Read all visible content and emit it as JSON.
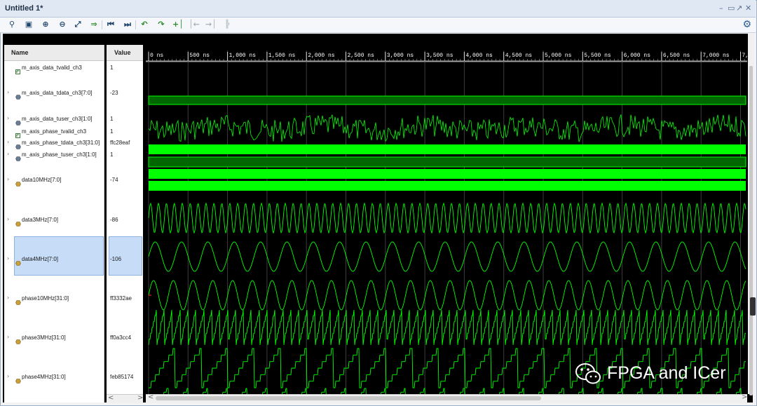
{
  "window": {
    "title": "Untitled 1*"
  },
  "toolbar": {
    "icons": [
      "search-icon",
      "save-icon",
      "zoom-in-icon",
      "zoom-out-icon",
      "zoom-fit-icon",
      "go-to-cursor-icon",
      "go-to-time-0-icon",
      "go-to-last-time-icon",
      "previous-transition-icon",
      "next-transition-icon",
      "add-marker-icon",
      "previous-marker-icon",
      "next-marker-icon",
      "swap-cursors-icon",
      "settings-gear-icon"
    ]
  },
  "columns": {
    "name": "Name",
    "value": "Value"
  },
  "signals": [
    {
      "name": "m_axis_data_tvalid_ch3",
      "value": "1",
      "type": "bit",
      "expandable": false
    },
    {
      "name": "m_axis_data_tdata_ch3[7:0]",
      "value": "-23",
      "type": "bus",
      "expandable": true
    },
    {
      "name": "m_axis_data_tuser_ch3[1:0]",
      "value": "1",
      "type": "bus",
      "expandable": true
    },
    {
      "name": "m_axis_phase_tvalid_ch3",
      "value": "1",
      "type": "bit",
      "expandable": false
    },
    {
      "name": "m_axis_phase_tdata_ch3[31:0]",
      "value": "ffc28eaf",
      "type": "bus",
      "expandable": true
    },
    {
      "name": "m_axis_phase_tuser_ch3[1:0]",
      "value": "1",
      "type": "bus",
      "expandable": true
    },
    {
      "name": "data10MHz[7:0]",
      "value": "-74",
      "type": "analog",
      "expandable": true
    },
    {
      "name": "data3MHz[7:0]",
      "value": "-86",
      "type": "analog",
      "expandable": true
    },
    {
      "name": "data4MHz[7:0]",
      "value": "-106",
      "type": "analog",
      "expandable": true,
      "selected": true
    },
    {
      "name": "phase10MHz[31:0]",
      "value": "ff3332ae",
      "type": "analog",
      "expandable": true
    },
    {
      "name": "phase3MHz[31:0]",
      "value": "ff0a3cc4",
      "type": "analog",
      "expandable": true
    },
    {
      "name": "phase4MHz[31:0]",
      "value": "feb85174",
      "type": "analog",
      "expandable": true
    }
  ],
  "timeline": {
    "labels": [
      "0 ns",
      "500 ns",
      "1,000 ns",
      "1,500 ns",
      "2,000 ns",
      "2,500 ns",
      "3,000 ns",
      "3,500 ns",
      "4,000 ns",
      "4,500 ns",
      "5,000 ns",
      "5,500 ns",
      "6,000 ns",
      "6,500 ns",
      "7,000 ns",
      "7,"
    ],
    "unit": "ns"
  },
  "colors": {
    "wave": "#00ff00",
    "bus_fill": "#00ff00",
    "valid_fill": "#006600",
    "background": "#000000",
    "selection": "#c7dcf6"
  },
  "watermark": {
    "text": "FPGA and ICer",
    "icon": "wechat-icon"
  }
}
